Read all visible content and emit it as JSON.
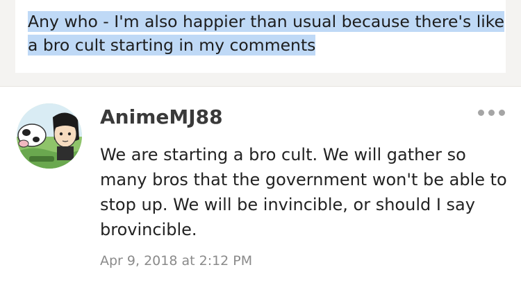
{
  "post": {
    "highlighted_text": "Any who - I'm also happier than usual because there's like a bro cult starting in my comments"
  },
  "comment": {
    "avatar_icon": "anime-character-avatar-icon",
    "username": "AnimeMJ88",
    "body": "We are starting a bro cult. We will gather so many bros that the government won't be able to stop up. We will be invincible, or should I say brovincible.",
    "timestamp": "Apr 9, 2018 at 2:12 PM",
    "more_icon": "more-options-icon"
  },
  "colors": {
    "highlight": "#bfd9f6",
    "background": "#f4f3f1",
    "timestamp": "#8a8a8a"
  }
}
